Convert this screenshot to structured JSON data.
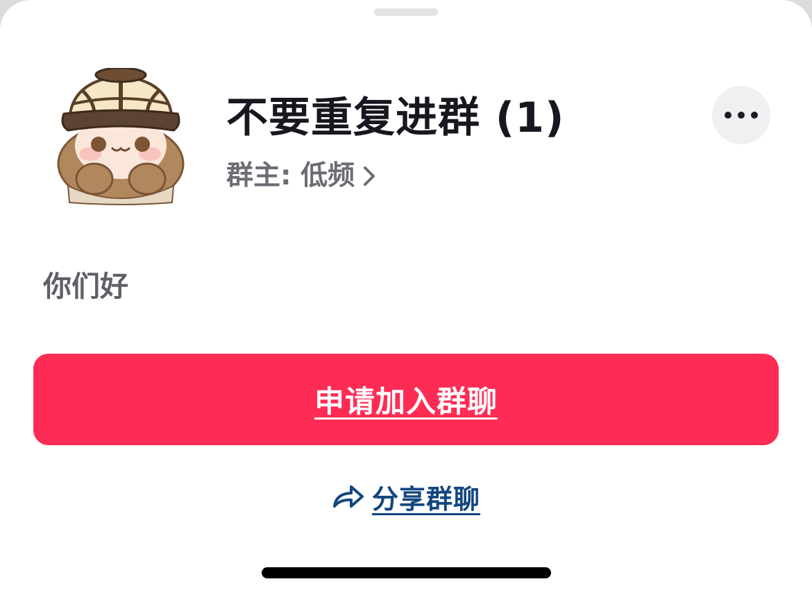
{
  "group": {
    "name": "不要重复进群 (1)",
    "owner_label": "群主: 低频",
    "description": "你们好"
  },
  "actions": {
    "join_label": "申请加入群聊",
    "share_label": "分享群聊"
  },
  "icons": {
    "more": "more-dots-icon",
    "owner_chevron": "chevron-right-icon",
    "share": "share-arrow-icon",
    "avatar": "detective-character-avatar"
  },
  "colors": {
    "primary": "#fe2c55",
    "link": "#12467f",
    "title": "#17171f",
    "secondary_text": "#6c6c75"
  }
}
